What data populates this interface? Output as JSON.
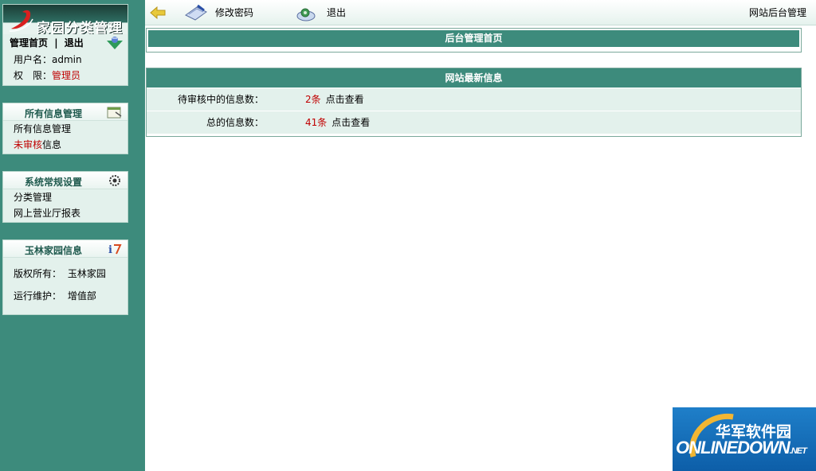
{
  "sidebar": {
    "logo_text": "家园分类管理",
    "user": {
      "home_link": "管理首页",
      "separator": "|",
      "logout_link": "退出",
      "username_label": "用户名：",
      "username": "admin",
      "role_label": "权　限：",
      "role": "管理员"
    },
    "sections": [
      {
        "title": "所有信息管理",
        "icon": "notepad-icon",
        "items": [
          {
            "label": "所有信息管理"
          },
          {
            "label_red": "未审核",
            "label": "信息"
          }
        ]
      },
      {
        "title": "系统常规设置",
        "icon": "gear-icon",
        "items": [
          {
            "label": "分类管理"
          },
          {
            "label": "网上营业厅报表"
          }
        ]
      },
      {
        "title": "玉林家园信息",
        "icon": "info-icon",
        "rows": [
          {
            "label": "版权所有：",
            "value": "玉林家园"
          },
          {
            "label": "运行维护：",
            "value": "增值部"
          }
        ]
      }
    ]
  },
  "topbar": {
    "change_password": "修改密码",
    "logout": "退出",
    "title": "网站后台管理"
  },
  "main": {
    "home_title": "后台管理首页",
    "latest": {
      "title": "网站最新信息",
      "rows": [
        {
          "label": "待审核中的信息数：",
          "count": "2条",
          "link": "点击查看"
        },
        {
          "label": "总的信息数：",
          "count": "41条",
          "link": "点击查看"
        }
      ]
    }
  },
  "watermark": {
    "cn": "华军软件园",
    "en": "ONLINEDOWN",
    "suffix": ".NET"
  },
  "colors": {
    "sidebar_bg": "#3d8b7c",
    "panel_bg": "#e3f1ec",
    "accent_red": "#c00000"
  }
}
